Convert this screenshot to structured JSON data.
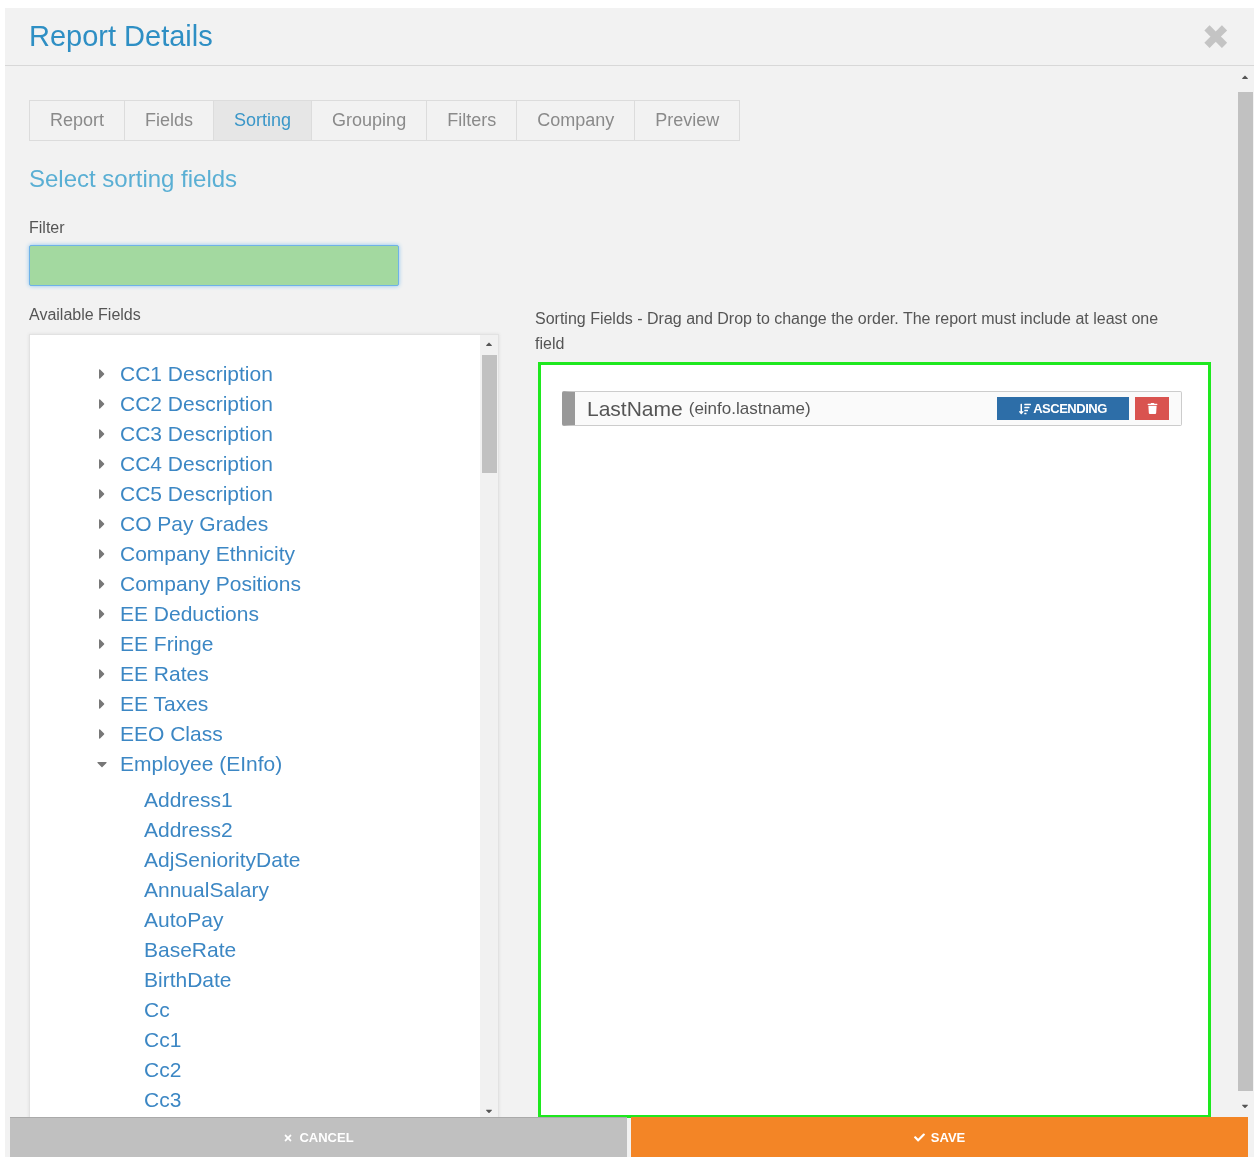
{
  "window": {
    "title": "Report Details",
    "close": "✖"
  },
  "tabs": [
    {
      "label": "Report",
      "selected": false
    },
    {
      "label": "Fields",
      "selected": false
    },
    {
      "label": "Sorting",
      "selected": true
    },
    {
      "label": "Grouping",
      "selected": false
    },
    {
      "label": "Filters",
      "selected": false
    },
    {
      "label": "Company",
      "selected": false
    },
    {
      "label": "Preview",
      "selected": false
    }
  ],
  "heading": "Select sorting fields",
  "filter": {
    "label": "Filter"
  },
  "available": {
    "label": "Available Fields",
    "items": [
      {
        "label": "CC1 Description",
        "expanded": false
      },
      {
        "label": "CC2 Description",
        "expanded": false
      },
      {
        "label": "CC3 Description",
        "expanded": false
      },
      {
        "label": "CC4 Description",
        "expanded": false
      },
      {
        "label": "CC5 Description",
        "expanded": false
      },
      {
        "label": "CO Pay Grades",
        "expanded": false
      },
      {
        "label": "Company Ethnicity",
        "expanded": false
      },
      {
        "label": "Company Positions",
        "expanded": false
      },
      {
        "label": "EE Deductions",
        "expanded": false
      },
      {
        "label": "EE Fringe",
        "expanded": false
      },
      {
        "label": "EE Rates",
        "expanded": false
      },
      {
        "label": "EE Taxes",
        "expanded": false
      },
      {
        "label": "EEO Class",
        "expanded": false
      },
      {
        "label": "Employee (EInfo)",
        "expanded": true,
        "children": [
          {
            "label": "Address1"
          },
          {
            "label": "Address2"
          },
          {
            "label": "AdjSeniorityDate"
          },
          {
            "label": "AnnualSalary"
          },
          {
            "label": "AutoPay"
          },
          {
            "label": "BaseRate"
          },
          {
            "label": "BirthDate"
          },
          {
            "label": "Cc"
          },
          {
            "label": "Cc1"
          },
          {
            "label": "Cc2"
          },
          {
            "label": "Cc3"
          }
        ]
      }
    ]
  },
  "sorting": {
    "label": "Sorting Fields - Drag and Drop to change the order. The report must include at least one field",
    "fields": [
      {
        "name": "LastName",
        "path": "(einfo.lastname)",
        "direction": "ASCENDING"
      }
    ]
  },
  "buttons": [
    {
      "kind": "cancel",
      "label": "CANCEL"
    },
    {
      "kind": "save",
      "label": "SAVE"
    }
  ]
}
